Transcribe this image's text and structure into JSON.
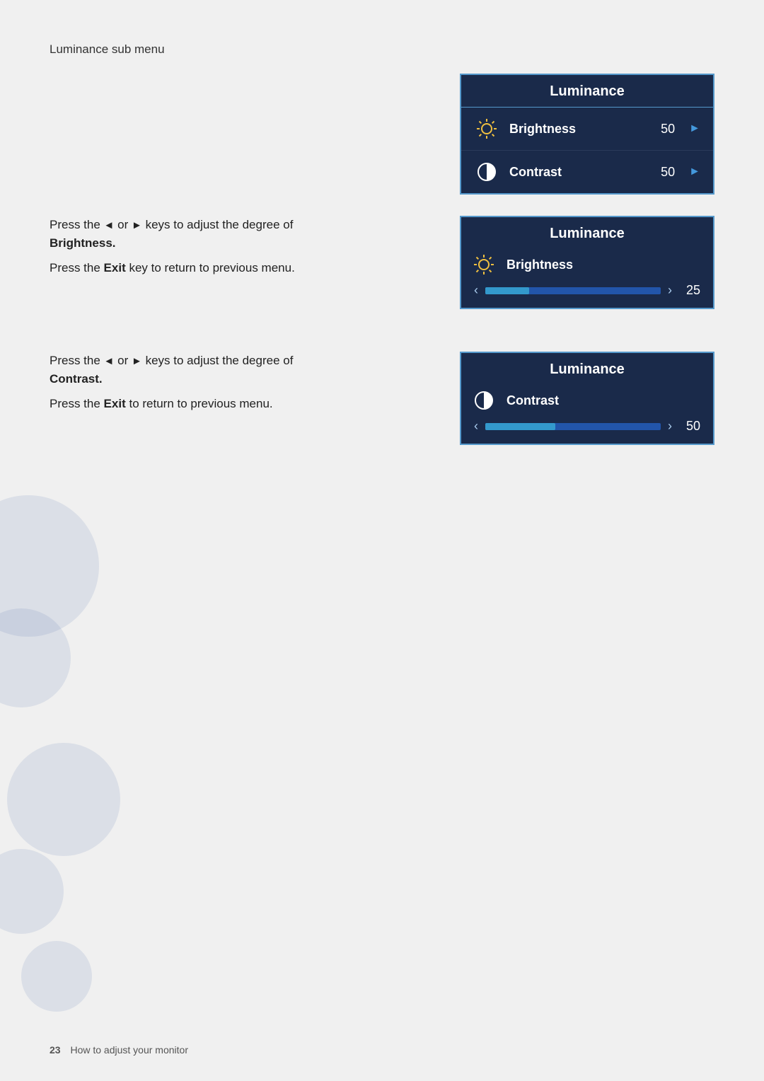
{
  "page": {
    "section_heading": "Luminance sub menu",
    "footer_page_num": "23",
    "footer_text": "How to adjust your monitor"
  },
  "main_osd": {
    "title": "Luminance",
    "rows": [
      {
        "label": "Brightness",
        "value": "50",
        "icon": "brightness"
      },
      {
        "label": "Contrast",
        "value": "50",
        "icon": "contrast"
      }
    ]
  },
  "brightness_section": {
    "desc1_before": "Press the",
    "desc1_left_arrow": "◄",
    "desc1_or": "or",
    "desc1_right_arrow": "►",
    "desc1_after": "keys to adjust the degree of",
    "desc1_bold": "Brightness.",
    "desc2_before": "Press the",
    "desc2_key": "Exit",
    "desc2_after": "key to return to previous menu.",
    "osd": {
      "title": "Luminance",
      "item_label": "Brightness",
      "slider_fill_pct": 25,
      "value": "25",
      "left_arrow": "‹",
      "right_arrow": "›"
    }
  },
  "contrast_section": {
    "desc1_before": "Press the",
    "desc1_left_arrow": "◄",
    "desc1_or": "or",
    "desc1_right_arrow": "►",
    "desc1_after": "keys to adjust the degree of",
    "desc1_bold": "Contrast.",
    "desc2_before": "Press the",
    "desc2_key": "Exit",
    "desc2_after": "to return to previous menu.",
    "osd": {
      "title": "Luminance",
      "item_label": "Contrast",
      "slider_fill_pct": 40,
      "value": "50",
      "left_arrow": "‹",
      "right_arrow": "›"
    }
  },
  "icons": {
    "brightness_unicode": "✳",
    "contrast_unicode": "◑"
  }
}
